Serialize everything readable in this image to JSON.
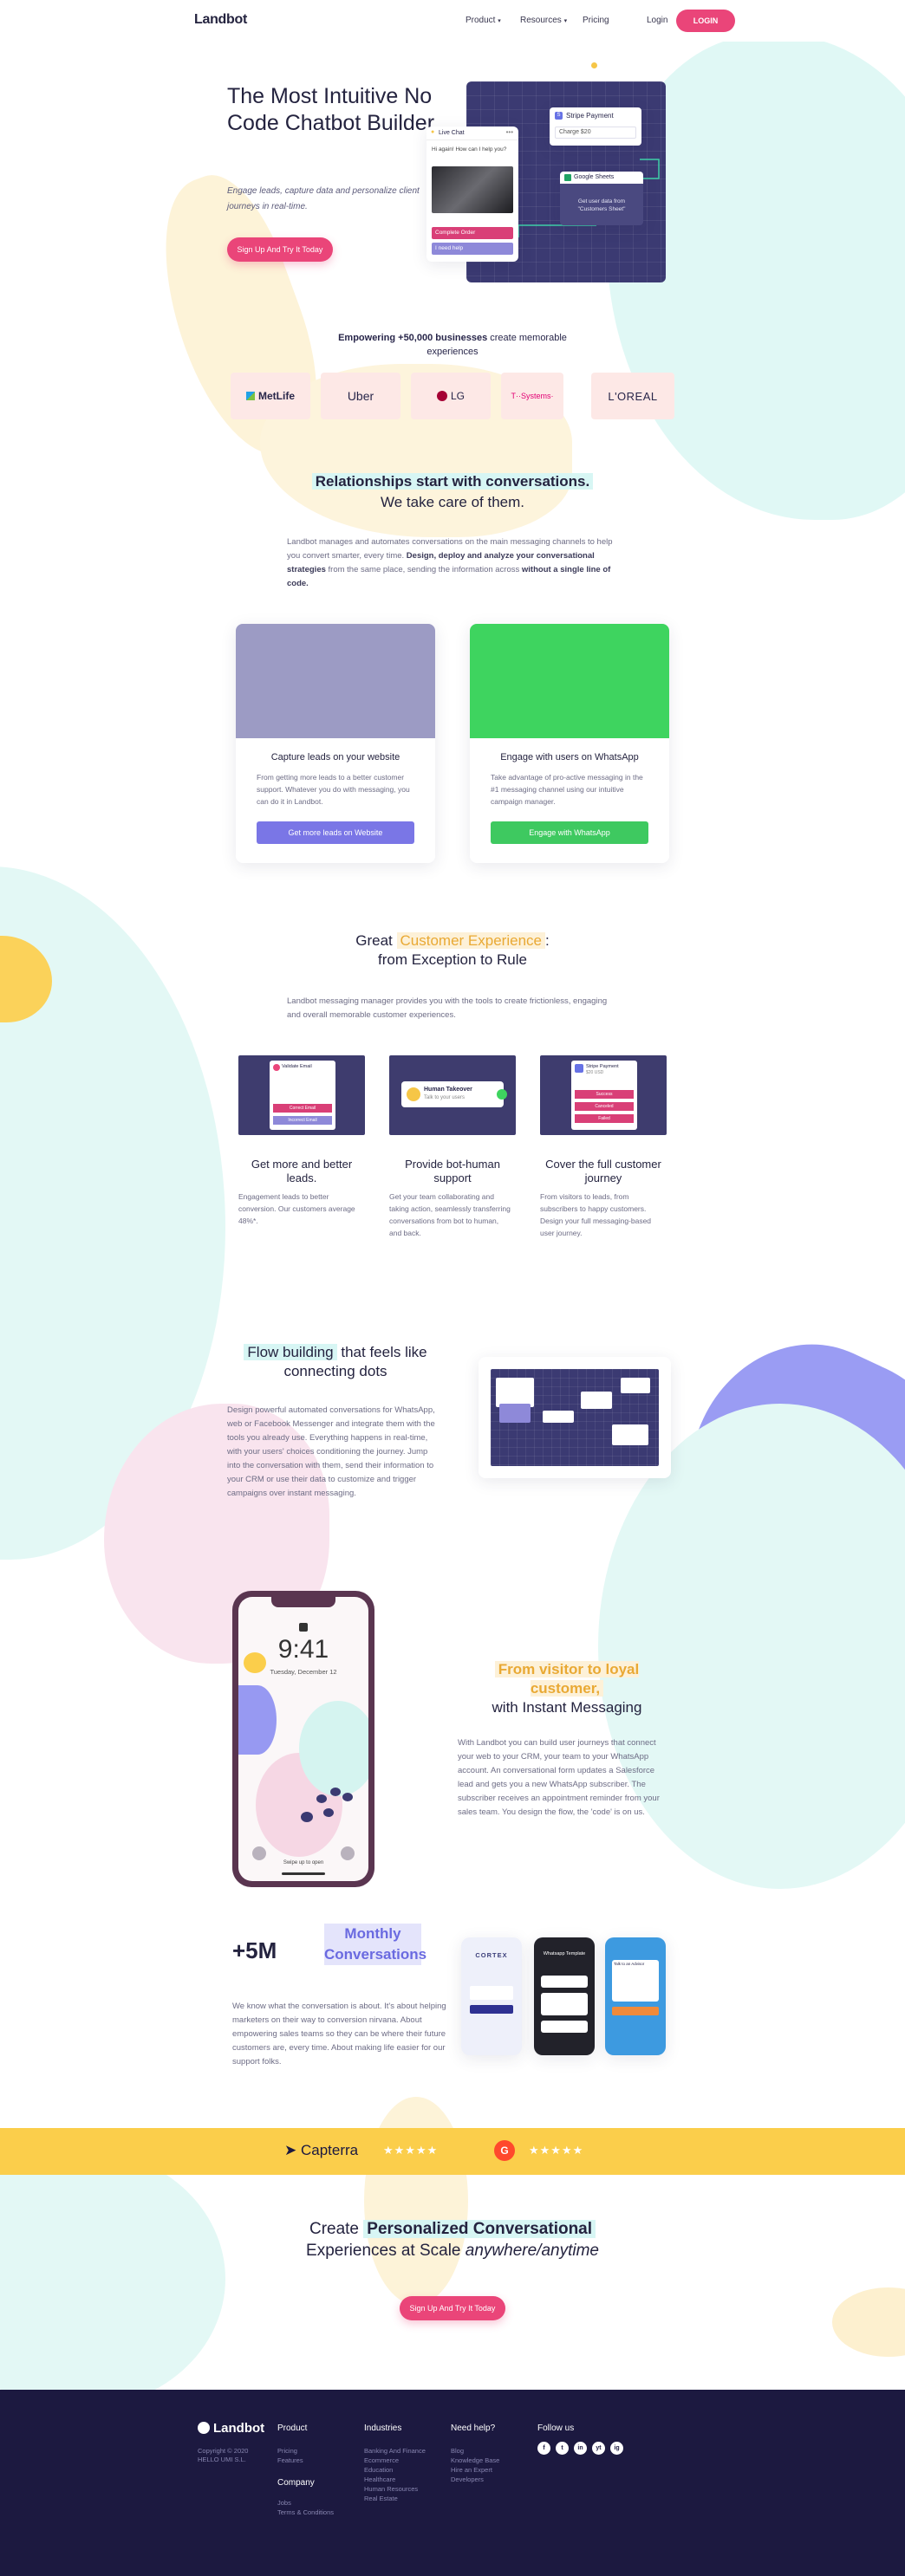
{
  "header": {
    "logo": "Landbot",
    "nav": [
      "Product",
      "Resources",
      "Pricing"
    ],
    "login": "Login",
    "login_button": "LOGIN"
  },
  "hero": {
    "title": "The Most Intuitive No Code Chatbot Builder",
    "subtitle": "Engage leads, capture data and personalize client journeys in real-time.",
    "cta": "Sign Up And Try It Today",
    "mock": {
      "live_chat": "Live Chat",
      "greeting": "Hi again! How can I help you?",
      "complete_order": "Complete Order",
      "need_help": "I need help",
      "stripe": "Stripe Payment",
      "charge": "Charge $20",
      "sheets": "Google Sheets",
      "get_user_data": "Get user data from \"Customers Sheet\""
    }
  },
  "empower": {
    "text_bold": "Empowering +50,000 businesses",
    "text_rest": " create memorable experiences",
    "logos": [
      "MetLife",
      "Uber",
      "LG",
      "T··Systems·",
      "L'OREAL"
    ]
  },
  "relationships": {
    "title_hl": "Relationships start with conversations.",
    "title_rest": "We take care of them.",
    "body_part1": "Landbot manages and automates conversations on the main messaging channels to help you convert smarter, every time. ",
    "body_bold1": "Design, deploy and analyze your conversational strategies",
    "body_part2": " from the same place, sending the information across ",
    "body_bold2": "without a single line of code."
  },
  "channels": [
    {
      "title": "Capture leads on your website",
      "text": "From getting more leads to a better customer support. Whatever you do with messaging, you can do it in Landbot.",
      "button": "Get more leads on Website",
      "color": "#7a76e6",
      "img_color": "#9c9bc4"
    },
    {
      "title": "Engage with users on WhatsApp",
      "text": "Take advantage of pro-active messaging in the #1 messaging channel using our intuitive campaign manager.",
      "button": "Engage with WhatsApp",
      "color": "#3ec960",
      "img_color": "#3ed45f"
    }
  ],
  "cx": {
    "title_pre": "Great ",
    "title_hl": "Customer Experience",
    "title_post": ":",
    "title_line2": "from Exception to Rule",
    "body": "Landbot messaging manager provides you with the tools to create frictionless, engaging and overall memorable customer experiences.",
    "features": [
      {
        "title": "Get more and better leads.",
        "text": "Engagement leads to better conversion. Our customers average 48%*.",
        "mock_label": "Validate Email",
        "buttons": [
          "Correct Email",
          "Incorrect Email"
        ]
      },
      {
        "title": "Provide bot-human support",
        "text": "Get your team collaborating and taking action, seamlessly transferring conversations from bot to human, and back.",
        "mock_label": "Human Takeover",
        "mock_sub": "Talk to your users"
      },
      {
        "title": "Cover the full customer journey",
        "text": "From visitors to leads, from subscribers to happy customers. Design your full messaging-based user journey.",
        "mock_label": "Stripe Payment",
        "mock_sub": "$20 USD",
        "buttons": [
          "Success",
          "Canceled",
          "Failed"
        ]
      }
    ]
  },
  "flow": {
    "title_hl": "Flow building",
    "title_rest": " that feels like",
    "title_line2": "connecting dots",
    "body": "Design powerful automated conversations for WhatsApp, web or Facebook Messenger and integrate them with the tools you already use. Everything happens in real-time, with your users' choices conditioning the journey. Jump into the conversation with them, send their information to your CRM or use their data to customize and trigger campaigns over instant messaging."
  },
  "phone": {
    "time": "9:41",
    "date": "Tuesday, December 12",
    "swipe": "Swipe up to open"
  },
  "visitor": {
    "title_hl": "From visitor to loyal customer,",
    "title_rest": "with Instant Messaging",
    "body": "With Landbot you can build user journeys that connect your web to your CRM, your team to your WhatsApp account. An conversational form updates a Salesforce lead and gets you a new WhatsApp subscriber. The subscriber receives an appointment reminder from your sales team. You design the flow, the 'code' is on us."
  },
  "stats": {
    "number": "+5M",
    "label": "Monthly Conversations",
    "body": "We know what the conversation is about. It's about helping marketers on their way to conversion nirvana. About empowering sales teams so they can be where their future customers are, every time. About making life easier for our support folks.",
    "phone_labels": [
      "CORTEX",
      "Whatsapp Template",
      "Talk to an Advisor"
    ]
  },
  "ratings": {
    "capterra": "Capterra",
    "stars": "★★★★★"
  },
  "final_cta": {
    "pre": "Create ",
    "hl": "Personalized Conversational",
    "line2_pre": "Experiences at Scale ",
    "line2_it": "anywhere/anytime",
    "button": "Sign Up And Try It Today"
  },
  "footer": {
    "logo": "Landbot",
    "copyright": "Copyright © 2020",
    "company_name": "HELLO UMI S.L.",
    "product_title": "Product",
    "product_links": [
      "Pricing",
      "Features"
    ],
    "company_title": "Company",
    "company_links": [
      "Jobs",
      "Terms & Conditions"
    ],
    "industries_title": "Industries",
    "industries_links": [
      "Banking And Finance",
      "Ecommerce",
      "Education",
      "Healthcare",
      "Human Resources",
      "Real Estate"
    ],
    "help_title": "Need help?",
    "help_links": [
      "Blog",
      "Knowledge Base",
      "Hire an Expert",
      "Developers"
    ],
    "follow_title": "Follow us",
    "socials": [
      "f",
      "t",
      "in",
      "yt",
      "ig"
    ]
  },
  "colors": {
    "accent": "#ea4579",
    "navy": "#1c1940",
    "yellow": "#fbce4b",
    "cyan": "#d7f6f4",
    "purple_blob": "#9799f2"
  }
}
